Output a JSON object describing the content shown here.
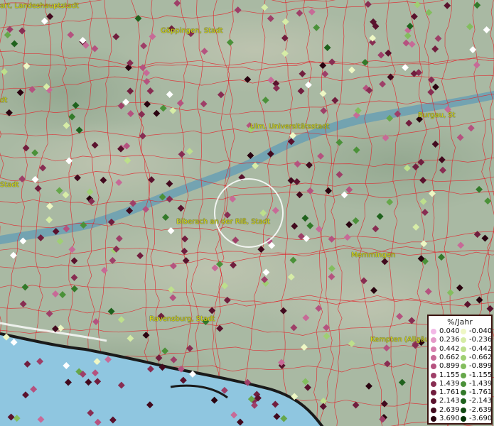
{
  "cities": [
    {
      "name": "art, Landeshauptstadt"
    },
    {
      "name": "Göppingen, Stadt"
    },
    {
      "name": "Ulm, Universitätsstadt"
    },
    {
      "name": "Burgau, St"
    },
    {
      "name": "Stadt"
    },
    {
      "name": "Biberach an der Riß, Stadt"
    },
    {
      "name": "Memmingen"
    },
    {
      "name": "Ravensburg, Stadt"
    },
    {
      "name": "Kempten (Allgäu"
    },
    {
      "name": "dt"
    }
  ],
  "legend": {
    "title": "%/Jahr",
    "positive": [
      {
        "label": "0.040",
        "color": "#f2b8e6"
      },
      {
        "label": "0.236",
        "color": "#e49ac8"
      },
      {
        "label": "0.442",
        "color": "#d77fae"
      },
      {
        "label": "0.662",
        "color": "#c76a97"
      },
      {
        "label": "0.899",
        "color": "#b5527f"
      },
      {
        "label": "1.155",
        "color": "#9e3f68"
      },
      {
        "label": "1.439",
        "color": "#882d52"
      },
      {
        "label": "1.761",
        "color": "#711e3e"
      },
      {
        "label": "2.143",
        "color": "#5a122d"
      },
      {
        "label": "2.639",
        "color": "#420a1e"
      },
      {
        "label": "3.690",
        "color": "#2a0410"
      }
    ],
    "negative": [
      {
        "label": "-0.040",
        "color": "#eef7c4"
      },
      {
        "label": "-0.236",
        "color": "#d6eca6"
      },
      {
        "label": "-0.442",
        "color": "#bddf8c"
      },
      {
        "label": "-0.662",
        "color": "#9fcf73"
      },
      {
        "label": "-0.899",
        "color": "#83bd5e"
      },
      {
        "label": "-1.155",
        "color": "#66a74a"
      },
      {
        "label": "-1.439",
        "color": "#4b9139"
      },
      {
        "label": "-1.761",
        "color": "#337a2a"
      },
      {
        "label": "-2.143",
        "color": "#1f621d"
      },
      {
        "label": "-2.639",
        "color": "#114a12"
      },
      {
        "label": "-3.690",
        "color": "#063308"
      }
    ]
  },
  "colors": {
    "terrain": "#a9b9a3",
    "river": "#5d9ab6",
    "boundaries": "#e0252b",
    "lake": "#8fc6e0",
    "zero_marker": "#ffffff"
  }
}
